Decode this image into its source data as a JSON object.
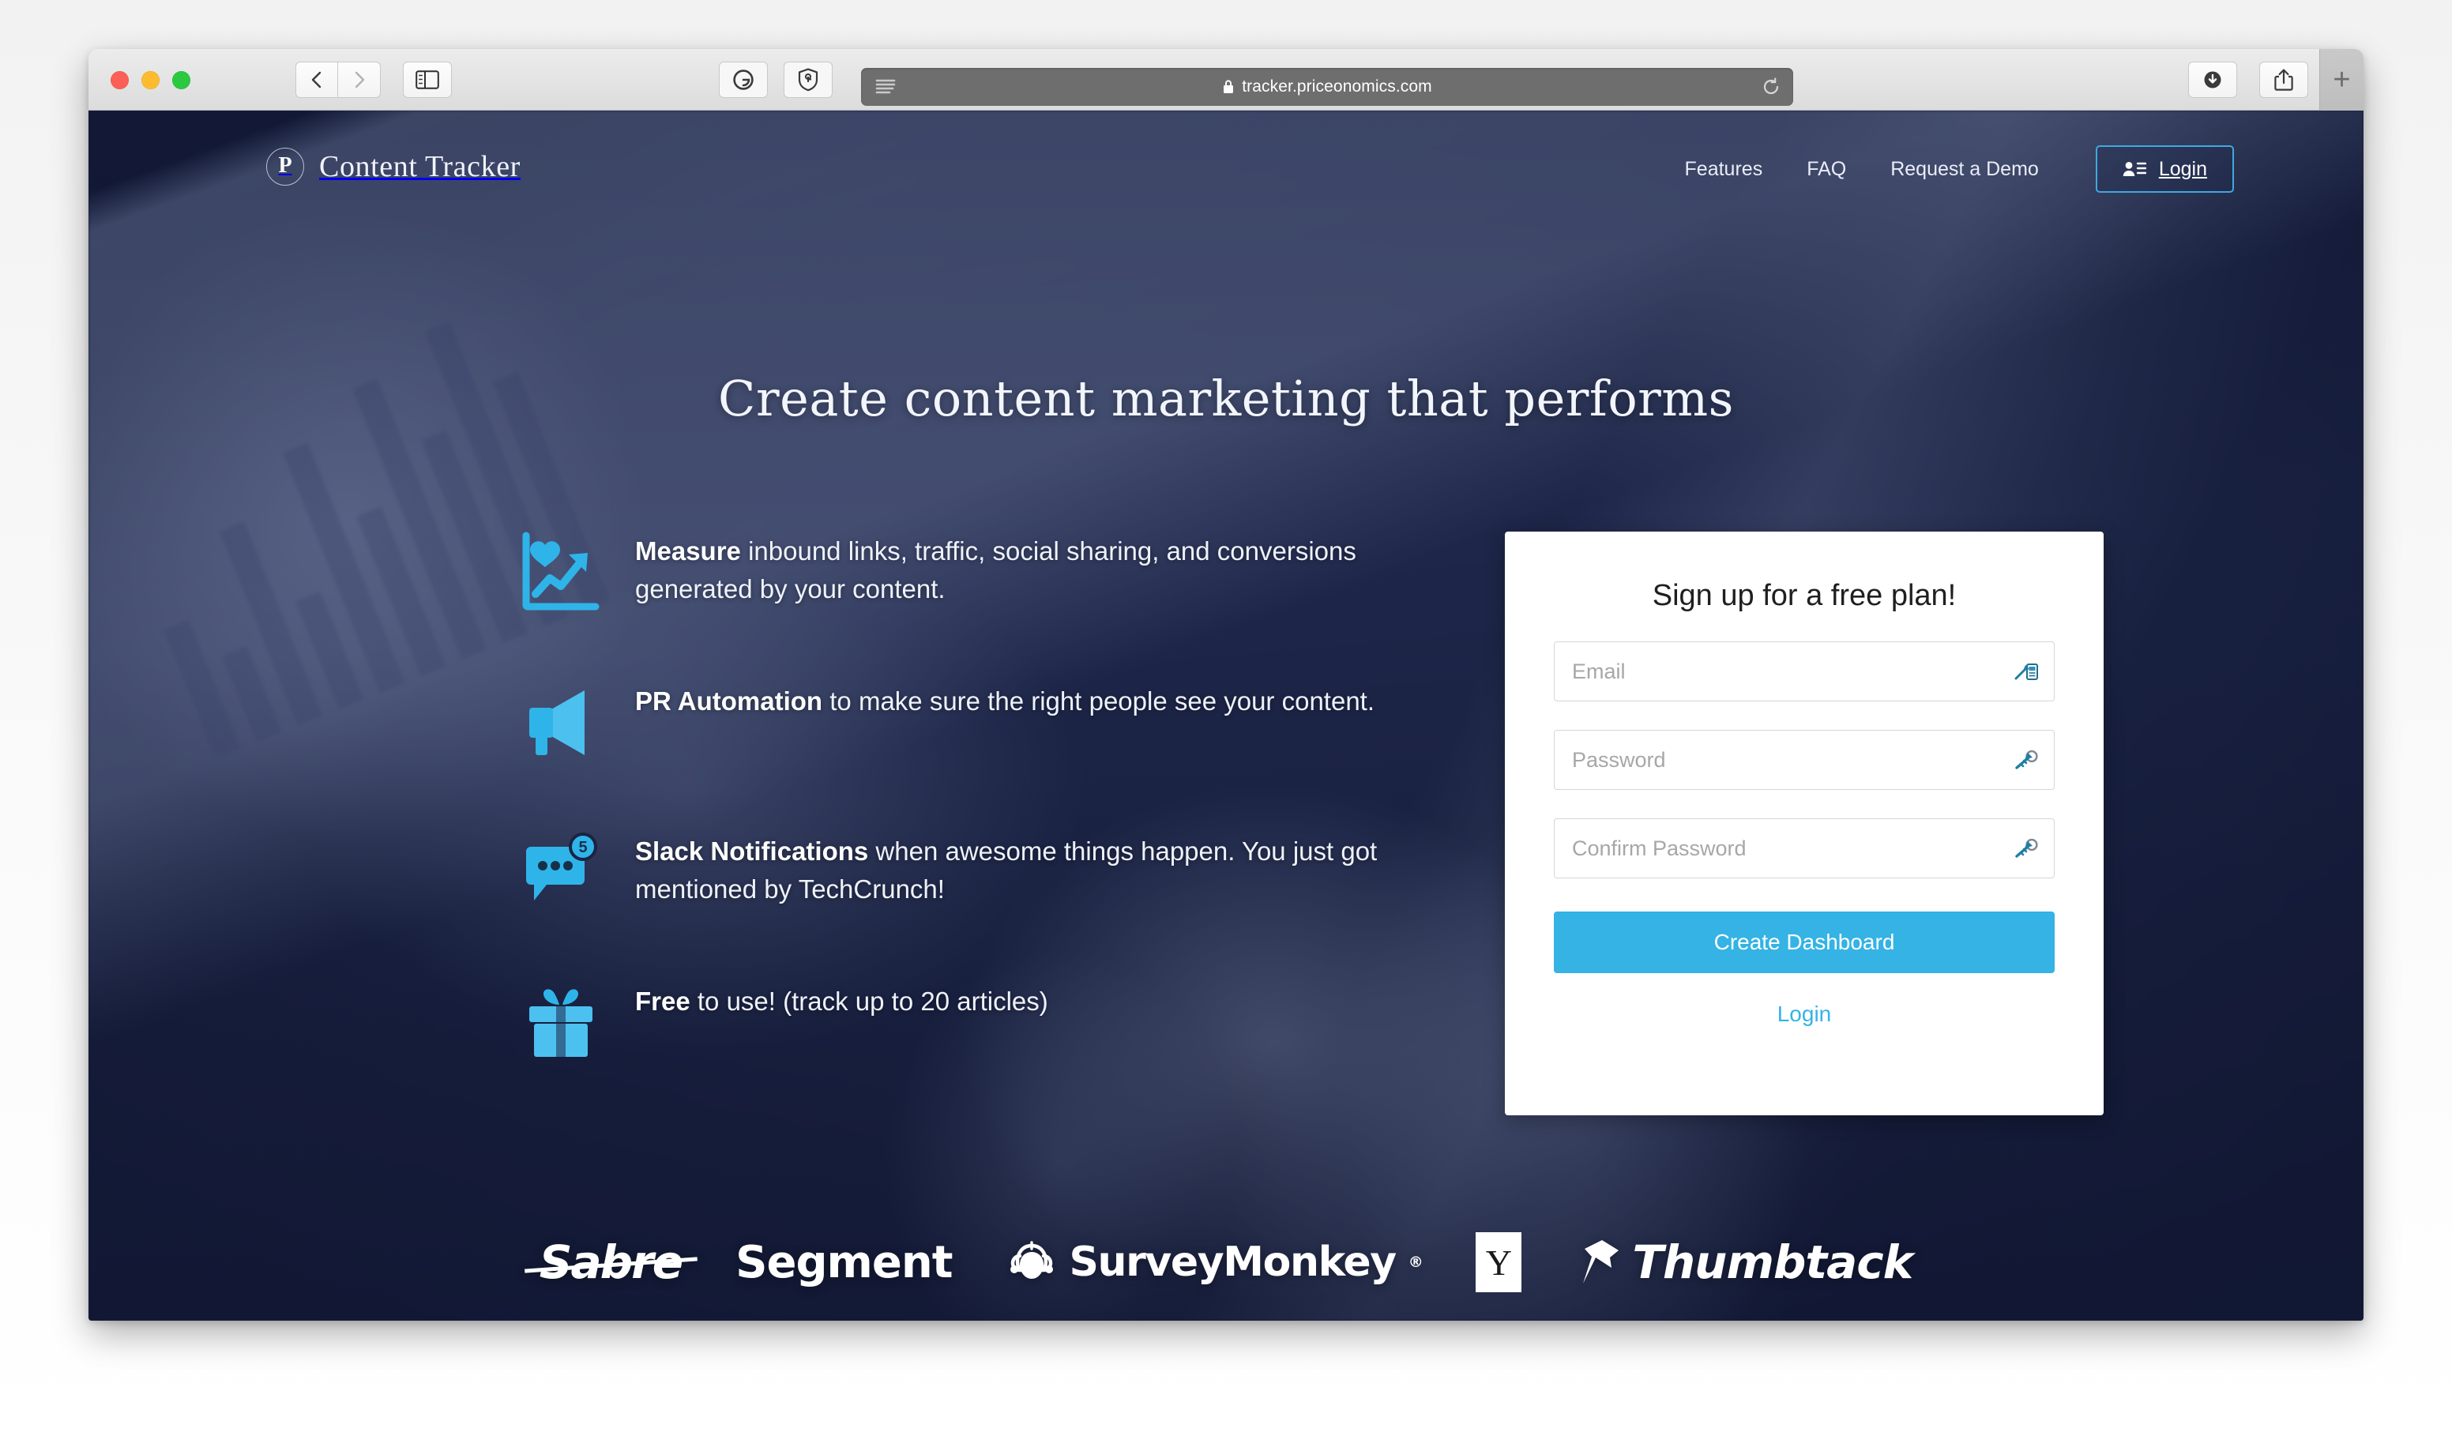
{
  "browser": {
    "url": "tracker.priceonomics.com",
    "lock_icon": "lock-icon",
    "reader_icon": "reader-view-icon",
    "reload_icon": "reload-icon",
    "back_icon": "back-chevron-icon",
    "forward_icon": "forward-chevron-icon",
    "sidebar_icon": "sidebar-toggle-icon",
    "grammarly_icon": "grammarly-extension-icon",
    "privacy_icon": "privacy-shield-extension-icon",
    "downloads_icon": "downloads-icon",
    "share_icon": "share-icon",
    "tabs_icon": "tab-overview-icon",
    "new_tab_label": "+"
  },
  "site": {
    "brand": {
      "mark": "P",
      "name": "Content Tracker"
    },
    "nav": [
      {
        "label": "Features"
      },
      {
        "label": "FAQ"
      },
      {
        "label": "Request a Demo"
      }
    ],
    "login_button": {
      "label": "Login",
      "icon": "user-list-icon"
    },
    "headline": "Create content marketing that performs"
  },
  "features": [
    {
      "icon": "line-chart-heart-icon",
      "strong": "Measure",
      "rest": " inbound links, traffic, social sharing, and conversions generated by your content."
    },
    {
      "icon": "megaphone-icon",
      "strong": "PR Automation",
      "rest": " to make sure the right people see your content."
    },
    {
      "icon": "chat-bubble-notification-icon",
      "badge": "5",
      "strong": "Slack Notifications",
      "rest": " when awesome things happen. You just got mentioned by TechCrunch!"
    },
    {
      "icon": "gift-box-icon",
      "strong": "Free",
      "rest": " to use! (track up to 20 articles)"
    }
  ],
  "signup": {
    "title": "Sign up for a free plan!",
    "email": {
      "placeholder": "Email",
      "value": "",
      "icon": "1password-autofill-icon"
    },
    "password": {
      "placeholder": "Password",
      "value": "",
      "icon": "1password-key-icon"
    },
    "confirm_password": {
      "placeholder": "Confirm Password",
      "value": "",
      "icon": "1password-key-icon"
    },
    "submit_label": "Create Dashboard",
    "login_link_label": "Login"
  },
  "clients": [
    {
      "name": "Sabre"
    },
    {
      "name": "Segment"
    },
    {
      "name": "SurveyMonkey",
      "mark": "®",
      "icon": "surveymonkey-monkey-icon"
    },
    {
      "name": "Y"
    },
    {
      "name": "Thumbtack",
      "icon": "pushpin-icon"
    }
  ],
  "colors": {
    "accent_blue": "#34b3e4",
    "icon_blue": "#2fb4e9",
    "hero_navy": "#1b2342",
    "login_border": "#3fa9e0"
  }
}
